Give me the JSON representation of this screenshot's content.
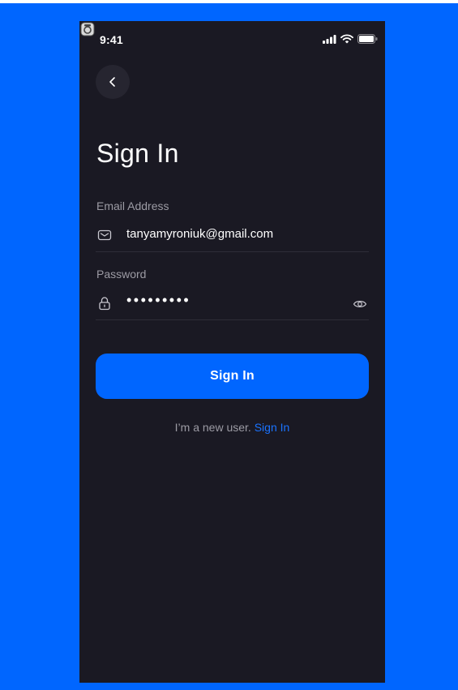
{
  "status_bar": {
    "time": "9:41",
    "icons": [
      "signal-icon",
      "wifi-icon",
      "battery-icon"
    ]
  },
  "corner_icon": "camera-badge-icon",
  "back_button": {
    "icon": "chevron-left-icon"
  },
  "title": "Sign In",
  "email": {
    "label": "Email Address",
    "value": "tanyamyroniuk@gmail.com",
    "icon": "mail-icon"
  },
  "password": {
    "label": "Password",
    "value": "•••••••••",
    "icon": "lock-icon",
    "toggle_icon": "eye-icon"
  },
  "submit_label": "Sign In",
  "footer": {
    "text": "I’m a new user. ",
    "link": "Sign In"
  },
  "colors": {
    "backdrop": "#0066ff",
    "screen": "#1a1923",
    "accent": "#0066ff",
    "muted_text": "#9c9ba4"
  }
}
